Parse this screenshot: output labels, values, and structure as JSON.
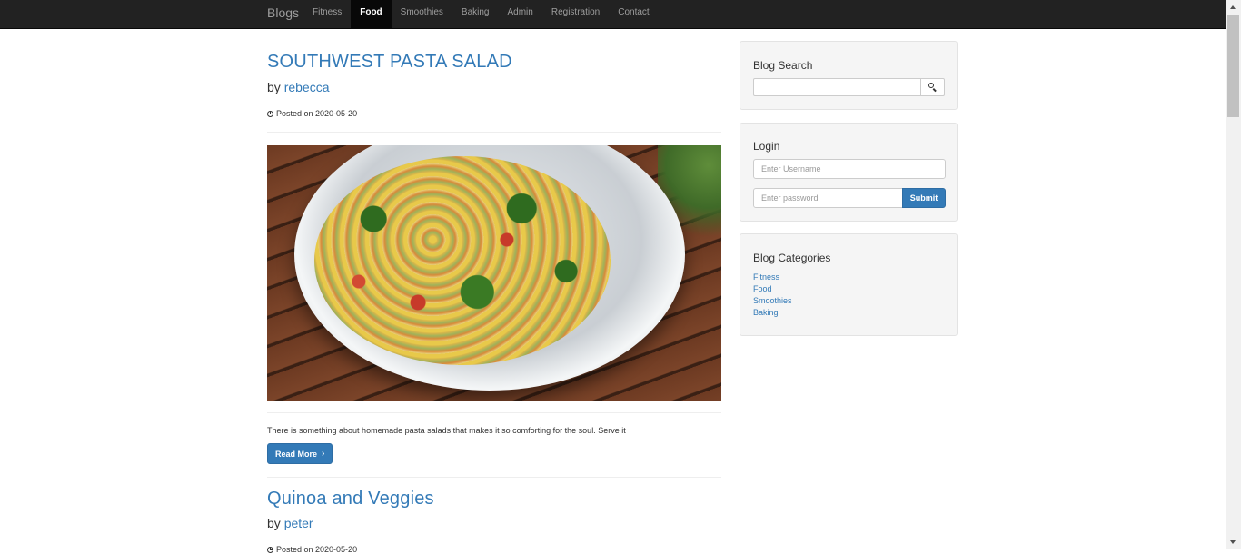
{
  "navbar": {
    "brand": "Blogs",
    "items": [
      {
        "label": "Fitness",
        "active": false
      },
      {
        "label": "Food",
        "active": true
      },
      {
        "label": "Smoothies",
        "active": false
      },
      {
        "label": "Baking",
        "active": false
      },
      {
        "label": "Admin",
        "active": false
      },
      {
        "label": "Registration",
        "active": false
      },
      {
        "label": "Contact",
        "active": false
      }
    ]
  },
  "posts": [
    {
      "title": "SOUTHWEST PASTA SALAD",
      "by": "by",
      "author": "rebecca",
      "posted": "Posted on 2020-05-20",
      "image_alt": "pasta salad in glass bowl",
      "excerpt": "There is something about homemade pasta salads that makes it so comforting for the soul. Serve it",
      "read_more": "Read More"
    },
    {
      "title": "Quinoa and Veggies",
      "by": "by",
      "author": "peter",
      "posted": "Posted on 2020-05-20"
    }
  ],
  "sidebar": {
    "search": {
      "title": "Blog Search",
      "value": ""
    },
    "login": {
      "title": "Login",
      "username_placeholder": "Enter Username",
      "password_placeholder": "Enter password",
      "submit": "Submit"
    },
    "categories": {
      "title": "Blog Categories",
      "items": [
        "Fitness",
        "Food",
        "Smoothies",
        "Baking"
      ]
    }
  },
  "colors": {
    "link": "#337ab7",
    "navbar": "#222222",
    "primary": "#337ab7"
  }
}
